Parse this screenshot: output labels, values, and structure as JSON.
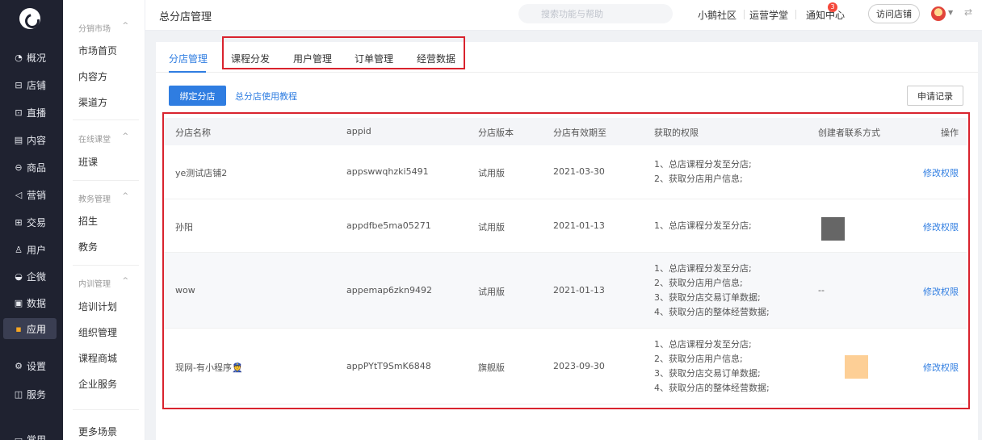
{
  "nav": {
    "items": [
      {
        "icon": "◔",
        "label": "概况"
      },
      {
        "icon": "⊟",
        "label": "店铺"
      },
      {
        "icon": "⊡",
        "label": "直播"
      },
      {
        "icon": "▤",
        "label": "内容"
      },
      {
        "icon": "⊖",
        "label": "商品"
      },
      {
        "icon": "◁",
        "label": "营销"
      },
      {
        "icon": "⊞",
        "label": "交易"
      },
      {
        "icon": "♙",
        "label": "用户"
      },
      {
        "icon": "◒",
        "label": "企微"
      },
      {
        "icon": "▣",
        "label": "数据"
      },
      {
        "icon": "▪",
        "label": "应用"
      },
      {
        "icon": "⚙",
        "label": "设置"
      },
      {
        "icon": "◫",
        "label": "服务"
      },
      {
        "icon": "▭",
        "label": "常用"
      }
    ],
    "active_label": "应用"
  },
  "submenu": {
    "groups": [
      {
        "title": "分销市场",
        "items": [
          "市场首页",
          "内容方",
          "渠道方"
        ]
      },
      {
        "title": "在线课堂",
        "items": [
          "班课"
        ]
      },
      {
        "title": "教务管理",
        "items": [
          "招生",
          "教务"
        ]
      },
      {
        "title": "内训管理",
        "items": [
          "培训计划",
          "组织管理",
          "课程商城",
          "企业服务"
        ]
      }
    ],
    "more": "更多场景"
  },
  "header": {
    "title": "总分店管理",
    "search_placeholder": "搜索功能与帮助",
    "links": [
      "小鹅社区",
      "运营学堂",
      "通知中心"
    ],
    "notify_count": "3",
    "visit_store": "访问店铺"
  },
  "tabs": [
    "分店管理",
    "课程分发",
    "用户管理",
    "订单管理",
    "经营数据"
  ],
  "actions": {
    "bind": "绑定分店",
    "tutorial": "总分店使用教程",
    "records": "申请记录"
  },
  "table": {
    "columns": [
      "分店名称",
      "appid",
      "分店版本",
      "分店有效期至",
      "获取的权限",
      "创建者联系方式",
      "操作"
    ],
    "rows": [
      {
        "name": "ye测试店铺2",
        "appid": "appswwqhzki5491",
        "version": "试用版",
        "expiry": "2021-03-30",
        "perms": [
          "1、总店课程分发至分店;",
          "2、获取分店用户信息;"
        ],
        "contact": "",
        "action": "修改权限"
      },
      {
        "name": "孙阳",
        "appid": "appdfbe5ma05271",
        "version": "试用版",
        "expiry": "2021-01-13",
        "perms": [
          "1、总店课程分发至分店;"
        ],
        "contact": "",
        "action": "修改权限"
      },
      {
        "name": "wow",
        "appid": "appemap6zkn9492",
        "version": "试用版",
        "expiry": "2021-01-13",
        "perms": [
          "1、总店课程分发至分店;",
          "2、获取分店用户信息;",
          "3、获取分店交易订单数据;",
          "4、获取分店的整体经营数据;"
        ],
        "contact": "--",
        "action": "修改权限"
      },
      {
        "name": "现网-有小程序👮",
        "appid": "appPYtT9SmK6848",
        "version": "旗舰版",
        "expiry": "2023-09-30",
        "perms": [
          "1、总店课程分发至分店;",
          "2、获取分店用户信息;",
          "3、获取分店交易订单数据;",
          "4、获取分店的整体经营数据;"
        ],
        "contact": "",
        "action": "修改权限"
      }
    ]
  },
  "colors": {
    "accent": "#2f7de1",
    "highlight_box": "#d9232e",
    "nav_bg": "#1f2230"
  }
}
